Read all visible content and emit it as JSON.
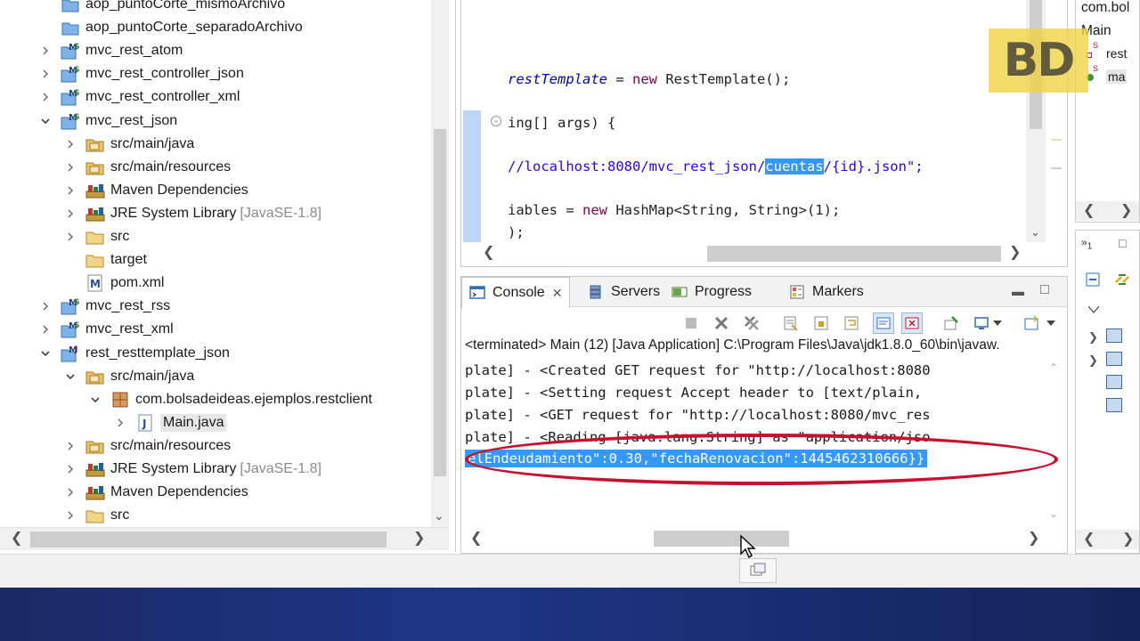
{
  "explorer": {
    "rows": [
      {
        "label": "aop_puntoCorte_mismoArchivo",
        "decor": ""
      },
      {
        "label": "aop_puntoCorte_separadoArchivo",
        "decor": ""
      },
      {
        "label": "mvc_rest_atom",
        "decor": ""
      },
      {
        "label": "mvc_rest_controller_json",
        "decor": ""
      },
      {
        "label": "mvc_rest_controller_xml",
        "decor": ""
      },
      {
        "label": "mvc_rest_json",
        "decor": ""
      },
      {
        "label": "src/main/java",
        "decor": ""
      },
      {
        "label": "src/main/resources",
        "decor": ""
      },
      {
        "label": "Maven Dependencies",
        "decor": ""
      },
      {
        "label": "JRE System Library",
        "decor": "[JavaSE-1.8]"
      },
      {
        "label": "src",
        "decor": ""
      },
      {
        "label": "target",
        "decor": ""
      },
      {
        "label": "pom.xml",
        "decor": ""
      },
      {
        "label": "mvc_rest_rss",
        "decor": ""
      },
      {
        "label": "mvc_rest_xml",
        "decor": ""
      },
      {
        "label": "rest_resttemplate_json",
        "decor": ""
      },
      {
        "label": "src/main/java",
        "decor": ""
      },
      {
        "label": "com.bolsadeideas.ejemplos.restclient",
        "decor": ""
      },
      {
        "label": "Main.java",
        "decor": ""
      },
      {
        "label": "src/main/resources",
        "decor": ""
      },
      {
        "label": "JRE System Library",
        "decor": "[JavaSE-1.8]"
      },
      {
        "label": "Maven Dependencies",
        "decor": ""
      },
      {
        "label": "src",
        "decor": ""
      }
    ]
  },
  "editor": {
    "line1": {
      "field": "restTemplate",
      "eq": " = ",
      "kw": "new",
      "rest": " RestTemplate();"
    },
    "line2": {
      "text": "ing[] args) {"
    },
    "line3": {
      "pre": "//localhost:8080/mvc_rest_json/",
      "sel": "cuentas",
      "post": "/{id}.json\";"
    },
    "line4": {
      "pre": "iables = ",
      "kw": "new",
      "rest": " HashMap<String, String>(1);"
    },
    "line5": {
      "text": ");"
    }
  },
  "console": {
    "tabs": {
      "console": "Console",
      "servers": "Servers",
      "progress": "Progress",
      "markers": "Markers"
    },
    "status": "<terminated> Main (12) [Java Application] C:\\Program Files\\Java\\jdk1.8.0_60\\bin\\javaw.",
    "lines": [
      "plate] - <Created GET request for \"http://localhost:8080",
      "plate] - <Setting request Accept header to [text/plain,",
      "plate] - <GET request for \"http://localhost:8080/mvc_res",
      "plate] - <Reading [java.lang.String] as \"application/jso"
    ],
    "highlighted": "elEndeudamiento\":0.30,\"fechaRenovacion\":1445462310666}}"
  },
  "outline": {
    "line1": "com.bol",
    "line2": "Main",
    "item1": "rest",
    "item2": "ma"
  },
  "logo": {
    "text": "BD"
  },
  "colors": {
    "accent_selection": "#3399ff",
    "keyword": "#7f0055",
    "annotation_red": "#c8102e"
  }
}
